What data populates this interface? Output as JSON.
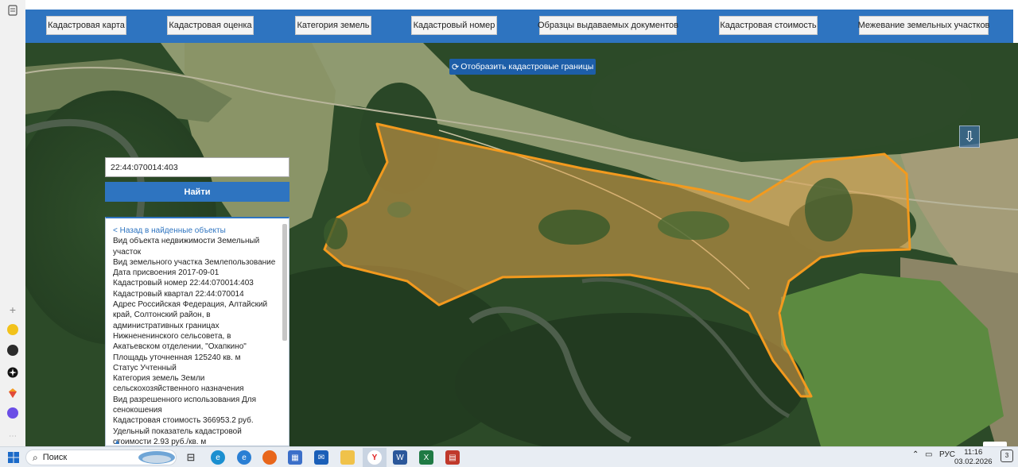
{
  "nav": {
    "items": [
      "Кадастровая карта",
      "Кадастровая оценка",
      "Категория земель",
      "Кадастровый номер",
      "Образцы выдаваемых документов",
      "Кадастровая стоимость",
      "Межевание земельных участков"
    ]
  },
  "map": {
    "toggle_label": "Отобразить кадастровые границы",
    "toggle_icon": "refresh-icon",
    "scroll_icon": "arrow-down-icon"
  },
  "search": {
    "value": "22:44:070014:403",
    "button_label": "Найти"
  },
  "info": {
    "back_link": "< Назад в найденные объекты",
    "lines": [
      "Вид объекта недвижимости Земельный участок",
      "Вид земельного участка Землепользование",
      "Дата присвоения 2017-09-01",
      "Кадастровый номер 22:44:070014:403",
      "Кадастровый квартал 22:44:070014",
      "Адрес Российская Федерация, Алтайский край, Солтонский район, в административных границах Нижнененинского сельсовета, в Акатьевском отделении, \"Охапкино\"",
      "Площадь уточненная 125240 кв. м",
      "Статус Учтенный",
      "Категория земель Земли сельскохозяйственного назначения",
      "Вид разрешенного использования Для сенокошения",
      "Кадастровая стоимость 366953.2 руб.",
      "Удельный показатель кадастровой стоимости 2.93 руб./кв. м"
    ],
    "scroll_up": "▲"
  },
  "taskbar": {
    "search_placeholder": "Поиск",
    "language": "РУС",
    "time": "11:16",
    "date": "03.02.2026",
    "notifications": "3"
  },
  "colors": {
    "nav_bg": "#2e74c0",
    "parcel_outline": "#f39a1e",
    "parcel_fill": "#e0a34a"
  }
}
